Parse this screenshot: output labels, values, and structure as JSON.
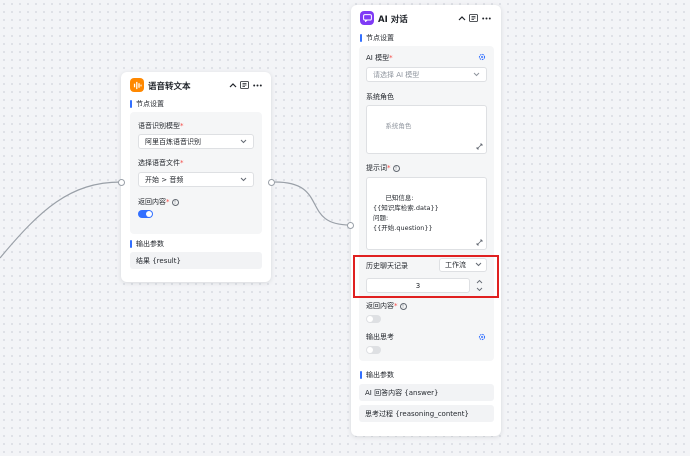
{
  "speech_node": {
    "title": "语音转文本",
    "section_settings": "节点设置",
    "model_label": "语音识别模型",
    "model_value": "阿里百炼语音识别",
    "file_label": "选择语音文件",
    "file_value": "开始 > 音频",
    "return_label": "返回内容",
    "return_on": true,
    "section_output": "输出参数",
    "output_rows": [
      "结果 {result}"
    ]
  },
  "ai_node": {
    "title": "AI 对话",
    "section_settings": "节点设置",
    "model_label": "AI 模型",
    "model_placeholder": "请选择 AI 模型",
    "role_label": "系统角色",
    "role_placeholder": "系统角色",
    "prompt_label": "提示词",
    "prompt_text": "已知信息:\n{{知识库检索.data}}\n问题:\n{{开始.question}}",
    "history_label": "历史聊天记录",
    "history_source": "工作流",
    "history_count": "3",
    "return_label": "返回内容",
    "return_on": false,
    "think_label": "输出思考",
    "think_on": false,
    "section_output": "输出参数",
    "output_rows": [
      "AI 回答内容 {answer}",
      "思考过程 {reasoning_content}"
    ]
  },
  "colors": {
    "accent": "#3370ff",
    "speech_icon": "#ff8800",
    "ai_icon": "#7f3bf5",
    "highlight": "#e02020",
    "toggle_off": "#dee0e3"
  },
  "icons": {
    "speech_node": "speech-to-text-icon",
    "ai_node": "chat-bubble-icon",
    "collapse": "chevron-up-icon",
    "more": "more-dots-icon",
    "settings": "gear-icon"
  }
}
